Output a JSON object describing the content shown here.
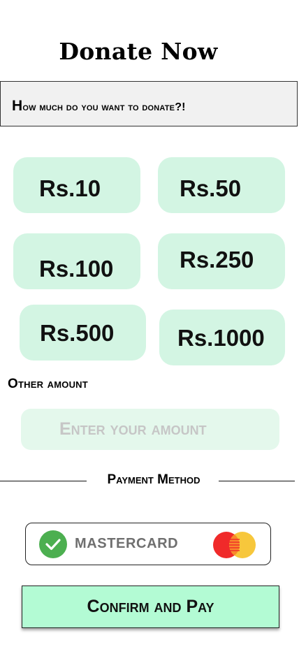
{
  "header": {
    "title": "Donate Now"
  },
  "question": {
    "first": "H",
    "rest": "ow much do you want  to donate?!"
  },
  "amounts": [
    "Rs.10",
    "Rs.50",
    "Rs.100",
    "Rs.250",
    "Rs.500",
    "Rs.1000"
  ],
  "other": {
    "label": "Other amount",
    "placeholder": "Enter your amount"
  },
  "payment": {
    "label": "Payment Method",
    "selected": "MASTERCARD",
    "check_icon": "check-icon",
    "card_icon": "mastercard-logo",
    "colors": {
      "check": "#4caf50",
      "mc_red": "#f02a2a",
      "mc_yellow": "#f7c73c"
    }
  },
  "confirm": {
    "label": "Confirm and Pay"
  },
  "colors": {
    "amount_bg": "#d3f5e3",
    "input_bg": "#e4f8ec",
    "confirm_bg": "#b3fbd4",
    "question_bg": "#f1f1f1"
  }
}
